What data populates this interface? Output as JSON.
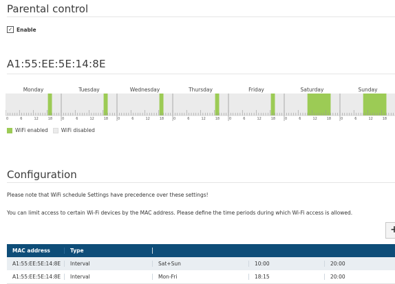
{
  "parental": {
    "title": "Parental control",
    "enable_label": "Enable",
    "enable_checked": true
  },
  "device": {
    "mac_title": "A1:55:EE:5E:14:8E"
  },
  "schedule": {
    "days": [
      "Monday",
      "Tuesday",
      "Wednesday",
      "Thursday",
      "Friday",
      "Saturday",
      "Sunday"
    ],
    "tick_labels": [
      "0",
      "6",
      "12",
      "18"
    ],
    "enabled_color": "#9ccb55",
    "disabled_color": "#ebebeb",
    "enabled_ranges": [
      {
        "day": "Monday",
        "start": "18:15",
        "end": "20:00"
      },
      {
        "day": "Tuesday",
        "start": "18:15",
        "end": "20:00"
      },
      {
        "day": "Wednesday",
        "start": "18:15",
        "end": "20:00"
      },
      {
        "day": "Thursday",
        "start": "18:15",
        "end": "20:00"
      },
      {
        "day": "Friday",
        "start": "18:15",
        "end": "20:00"
      },
      {
        "day": "Saturday",
        "start": "10:00",
        "end": "20:00"
      },
      {
        "day": "Sunday",
        "start": "10:00",
        "end": "20:00"
      }
    ],
    "legend": {
      "enabled": "WiFi enabled",
      "disabled": "WiFi disabled"
    }
  },
  "config": {
    "title": "Configuration",
    "note1": "Please note that WiFi schedule Settings have precedence over these settings!",
    "note2": "You can limit access to certain Wi-Fi devices by the MAC address. Please define the time periods during which Wi-Fi access is allowed.",
    "add_label": "+",
    "table": {
      "headers": [
        "MAC address",
        "Type",
        "",
        "",
        ""
      ],
      "rows": [
        [
          "A1:55:EE:5E:14:8E",
          "Interval",
          "Sat+Sun",
          "10:00",
          "20:00"
        ],
        [
          "A1:55:EE:5E:14:8E",
          "Interval",
          "Mon-Fri",
          "18:15",
          "20:00"
        ]
      ]
    }
  }
}
